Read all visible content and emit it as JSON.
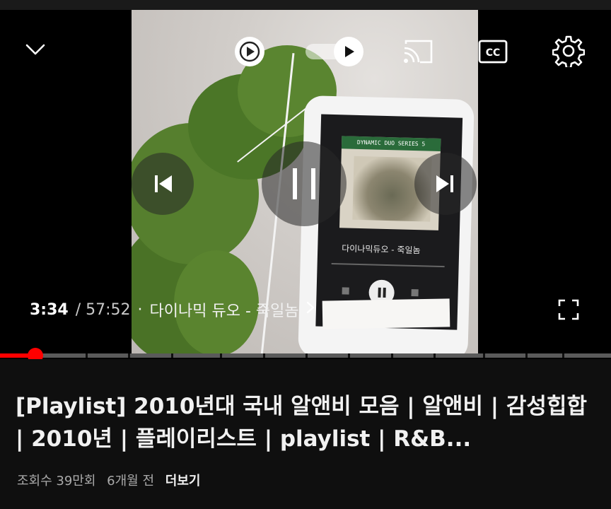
{
  "player": {
    "current_time": "3:34",
    "total_time": "/ 57:52",
    "chapter_separator": "·",
    "chapter_title": "다이나믹 듀오 - 죽일놈",
    "progress": 0.058,
    "chapter_markers": [
      0.14,
      0.21,
      0.28,
      0.36,
      0.43,
      0.5,
      0.57,
      0.64,
      0.71,
      0.79,
      0.86,
      0.92
    ],
    "autoplay_on": true,
    "accent_color": "#ff0000",
    "in_video": {
      "album_band": "DYNAMIC DUO SERIES 5",
      "song_text": "다이나믹듀오 - 죽일놈"
    }
  },
  "icons": {
    "minimize": "chevron-down-icon",
    "play_mode": "play-circle-icon",
    "autoplay": "autoplay-toggle-icon",
    "cast": "cast-icon",
    "captions": "cc-icon",
    "settings": "gear-icon",
    "previous": "skip-previous-icon",
    "pause": "pause-icon",
    "next": "skip-next-icon",
    "fullscreen": "fullscreen-icon",
    "chapter_more": "chevron-right-icon"
  },
  "video_info": {
    "title": "[Playlist] 2010년대 국내 알앤비 모음 | 알앤비 | 감성힙합 | 2010년 | 플레이리스트 | playlist | R&B...",
    "views": "조회수 39만회",
    "age": "6개월 전",
    "more_label": "더보기"
  }
}
